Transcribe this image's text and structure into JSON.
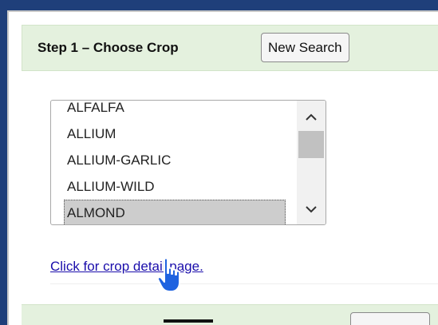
{
  "step1": {
    "title": "Step 1 – Choose Crop",
    "new_search_label": "New Search"
  },
  "crop_list": {
    "options": [
      "ALFALFA",
      "ALLIUM",
      "ALLIUM-GARLIC",
      "ALLIUM-WILD",
      "ALMOND"
    ],
    "selected": "ALMOND",
    "scroll_position": 0.15
  },
  "detail_link": {
    "label": "Click for crop detail page."
  },
  "icons": {
    "scroll_up": "chevron-up-icon",
    "scroll_down": "chevron-down-icon",
    "cursor": "hand-pointer-icon"
  },
  "colors": {
    "page_background": "#1f3f7a",
    "step_bar": "#e4f1de",
    "link": "#1a0dab",
    "selection": "#cdcdcd",
    "cursor_blue": "#1f63e0"
  }
}
